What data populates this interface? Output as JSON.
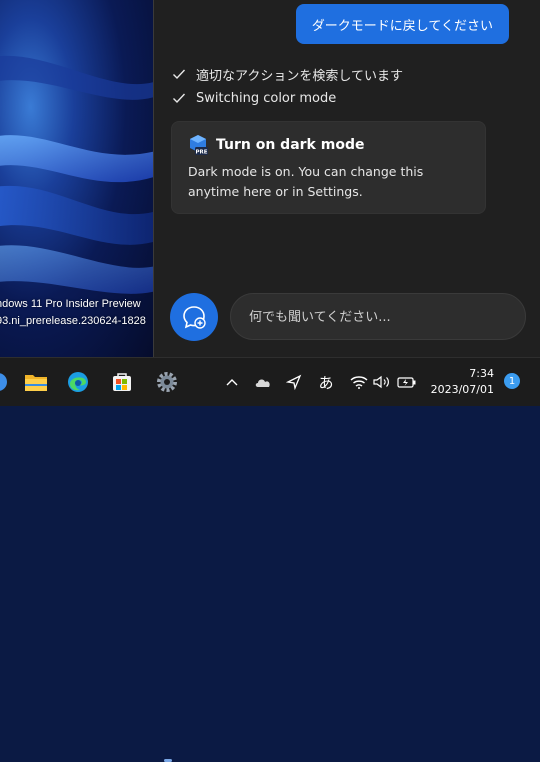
{
  "desktop": {
    "watermark_line1": "ndows 11 Pro Insider Preview",
    "watermark_line2": "93.ni_prerelease.230624-1828"
  },
  "copilot": {
    "user_message": "ダークモードに戻してください",
    "status": [
      "適切なアクションを検索しています",
      "Switching color mode"
    ],
    "card": {
      "title": "Turn on dark mode",
      "icon_badge": "PRE",
      "body": "Dark mode is on. You can change this anytime here or in Settings."
    },
    "input_placeholder": "何でも聞いてください..."
  },
  "taskbar": {
    "apps": [
      "start-icon",
      "file-explorer-icon",
      "edge-icon",
      "store-icon",
      "settings-icon"
    ],
    "tray": {
      "ime_label": "あ",
      "time": "7:34",
      "date": "2023/07/01",
      "notification_count": "1"
    }
  },
  "colors": {
    "accent": "#1f6fe0",
    "panel_bg": "#202020",
    "card_bg": "#2d2d2d",
    "taskbar_bg": "#1c1c1c"
  }
}
